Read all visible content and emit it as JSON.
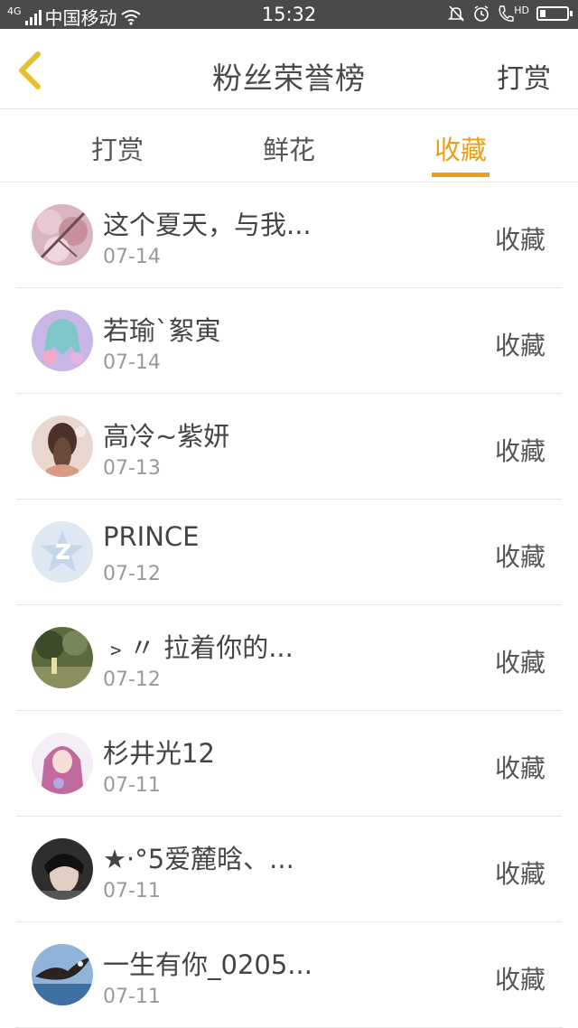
{
  "status_bar": {
    "network": "4G",
    "carrier": "中国移动",
    "time": "15:32",
    "hd": "HD"
  },
  "header": {
    "title": "粉丝荣誉榜",
    "right_action": "打赏",
    "back_color": "#e6c02a"
  },
  "tabs": {
    "items": [
      {
        "label": "打赏"
      },
      {
        "label": "鲜花"
      },
      {
        "label": "收藏"
      }
    ],
    "active_color": "#e6a019"
  },
  "fans": [
    {
      "name": "这个夏天，与我...",
      "date": "07-14",
      "action": "收藏",
      "avatar": "cherry-blossom-avatar"
    },
    {
      "name": "若瑜`絮寅",
      "date": "07-14",
      "action": "收藏",
      "avatar": "anime-girl-avatar"
    },
    {
      "name": "高冷~紫妍",
      "date": "07-13",
      "action": "收藏",
      "avatar": "braided-hair-avatar"
    },
    {
      "name": "PRINCE",
      "date": "07-12",
      "action": "收藏",
      "avatar": "qzone-star-avatar"
    },
    {
      "name": "﹥〃 拉着你的...",
      "date": "07-12",
      "action": "收藏",
      "avatar": "forest-scene-avatar"
    },
    {
      "name": "杉井光12",
      "date": "07-11",
      "action": "收藏",
      "avatar": "pink-hair-avatar"
    },
    {
      "name": "★·°5爱麓晗、...",
      "date": "07-11",
      "action": "收藏",
      "avatar": "dark-hair-boy-avatar"
    },
    {
      "name": "一生有你_0205...",
      "date": "07-11",
      "action": "收藏",
      "avatar": "eagle-avatar"
    }
  ]
}
